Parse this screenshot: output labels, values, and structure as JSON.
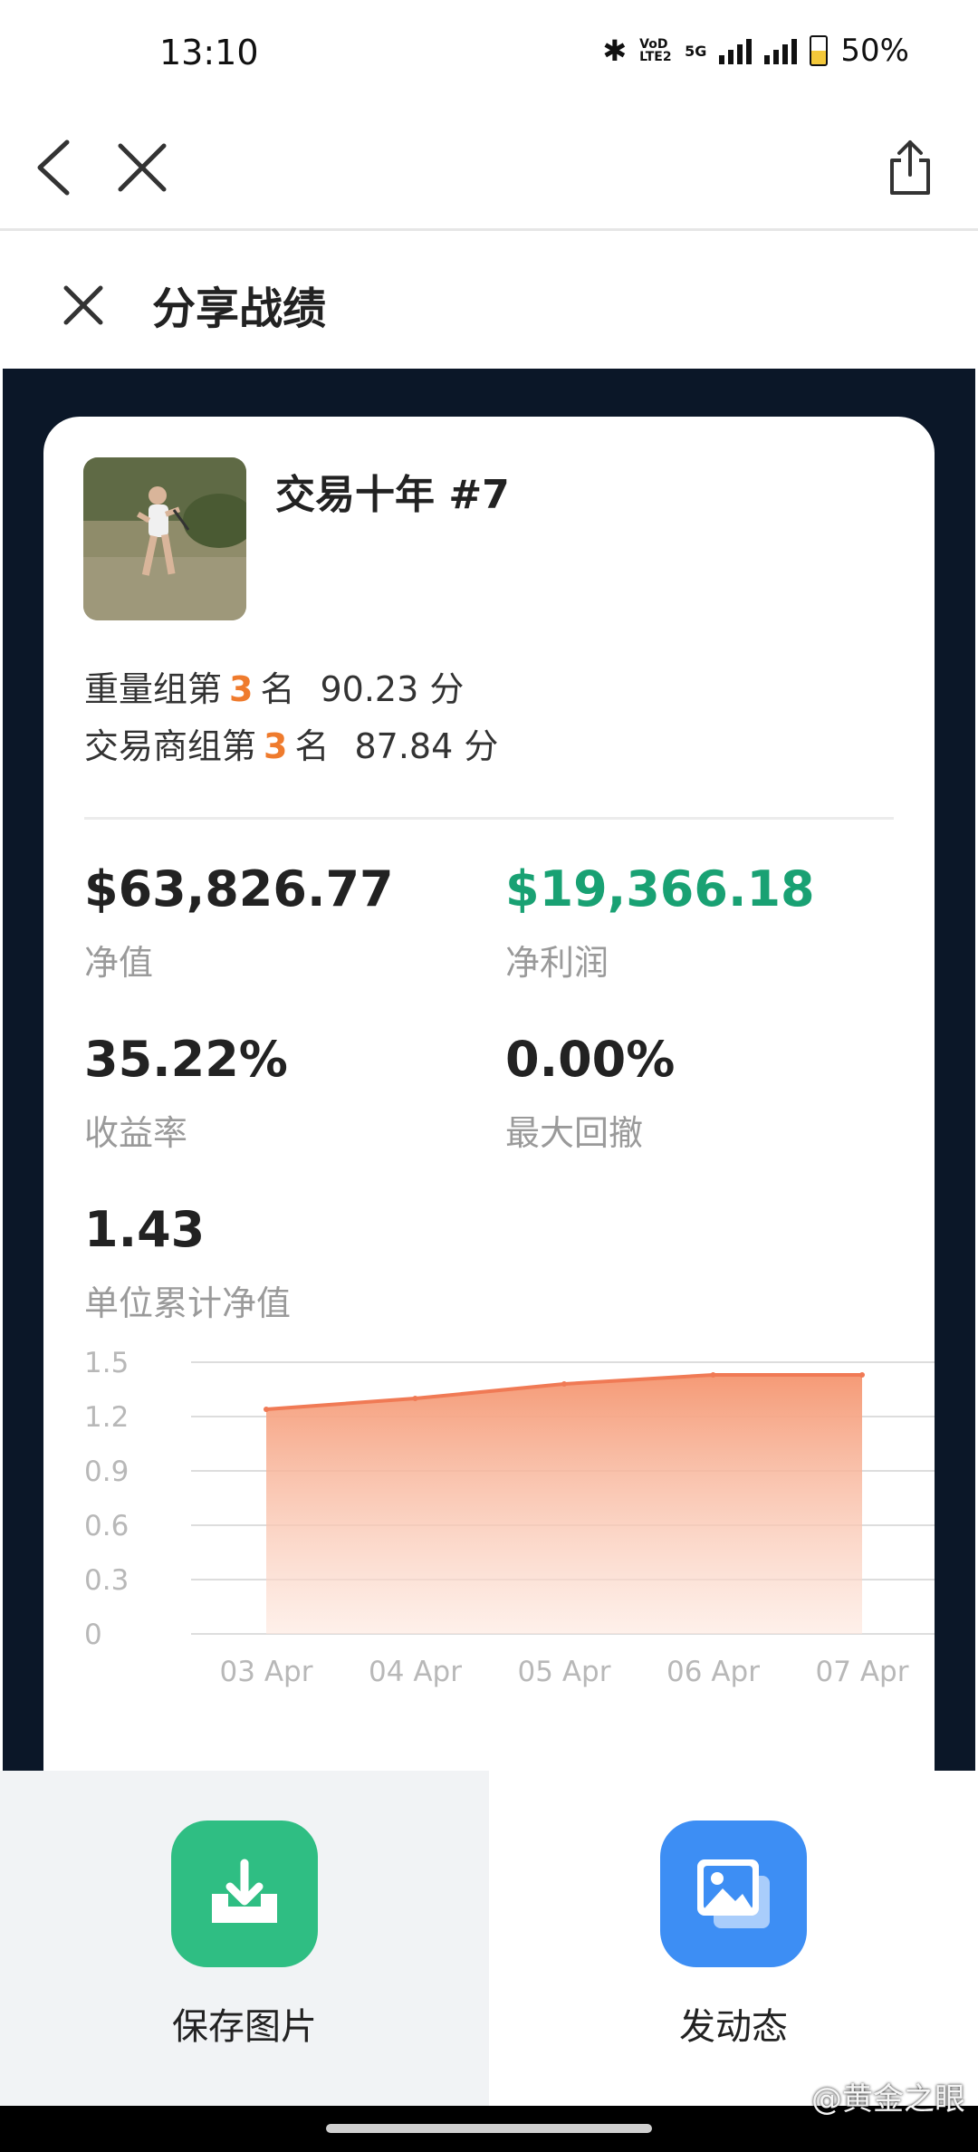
{
  "status_bar": {
    "time": "13:10",
    "network_1": "VoD LTE2",
    "network_2": "5G",
    "battery": "50%"
  },
  "sheet": {
    "title": "分享战绩"
  },
  "card": {
    "user_name": "交易十年 #7",
    "rank_lines": [
      {
        "prefix": "重量组第",
        "rank": "3",
        "suffix": "名",
        "score": "90.23 分"
      },
      {
        "prefix": "交易商组第",
        "rank": "3",
        "suffix": "名",
        "score": "87.84 分"
      }
    ],
    "stats": {
      "net_value": {
        "value": "$63,826.77",
        "label": "净值"
      },
      "net_profit": {
        "value": "$19,366.18",
        "label": "净利润"
      },
      "return_rate": {
        "value": "35.22%",
        "label": "收益率"
      },
      "max_drawdown": {
        "value": "0.00%",
        "label": "最大回撤"
      },
      "unit_nav": {
        "value": "1.43",
        "label": "单位累计净值"
      }
    }
  },
  "chart_data": {
    "type": "area",
    "x": [
      "03 Apr",
      "04 Apr",
      "05 Apr",
      "06 Apr",
      "07 Apr"
    ],
    "values": [
      1.24,
      1.3,
      1.38,
      1.43,
      1.43
    ],
    "ylim": [
      0,
      1.5
    ],
    "yticks": [
      "1.5",
      "1.2",
      "0.9",
      "0.6",
      "0.3",
      "0"
    ],
    "grid": true,
    "colors": {
      "line": "#f07a55",
      "fill_top": "#f59a76",
      "fill_bottom": "#fde6dc",
      "grid": "#dddddd",
      "tick": "#b8b8b8"
    }
  },
  "actions": {
    "save_image": "保存图片",
    "post": "发动态"
  },
  "watermark": "@黄金之眼",
  "colors": {
    "accent_orange": "#ef7b2d",
    "profit_green": "#19a173",
    "save_green": "#2fbe83",
    "post_blue": "#3d8ef4",
    "dark_bg": "#0b1728"
  }
}
